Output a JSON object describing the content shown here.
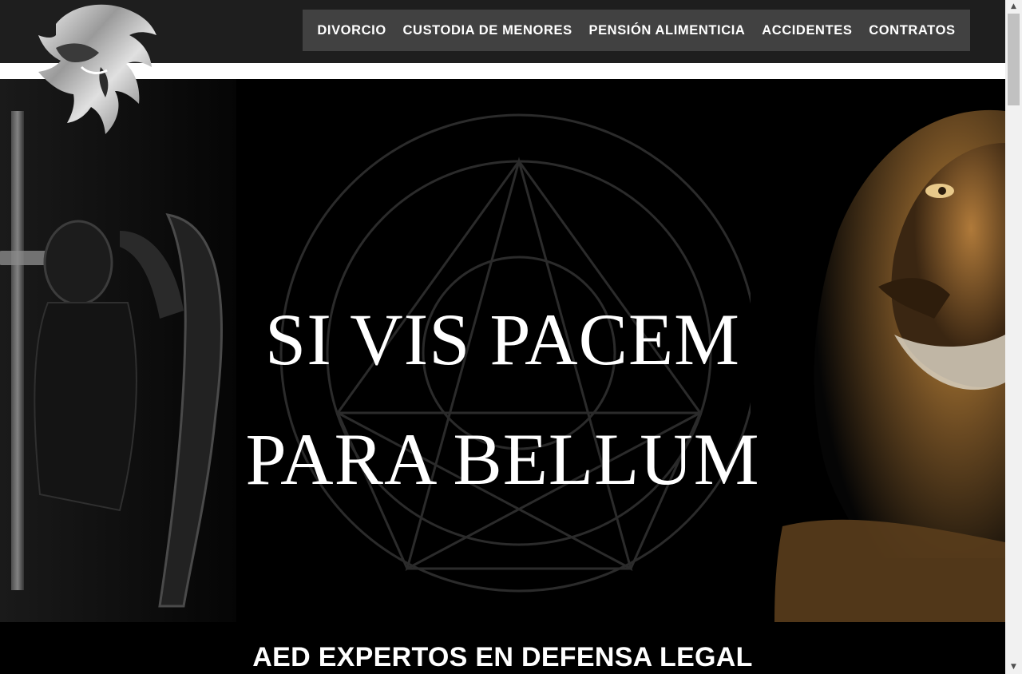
{
  "nav": {
    "items": [
      {
        "label": "DIVORCIO"
      },
      {
        "label": "CUSTODIA DE MENORES"
      },
      {
        "label": "PENSIÓN ALIMENTICIA"
      },
      {
        "label": "ACCIDENTES"
      },
      {
        "label": "CONTRATOS"
      }
    ]
  },
  "hero": {
    "line1": "SI VIS PACEM",
    "line2": "PARA BELLUM"
  },
  "section": {
    "title": "AED EXPERTOS EN DEFENSA LEGAL"
  },
  "colors": {
    "header_bg": "#1e1e1e",
    "nav_bg": "#414141",
    "hero_bg": "#000000",
    "text": "#ffffff"
  },
  "icons": {
    "logo": "lion-head-logo",
    "scroll_up": "triangle-up-icon",
    "scroll_down": "triangle-down-icon"
  }
}
